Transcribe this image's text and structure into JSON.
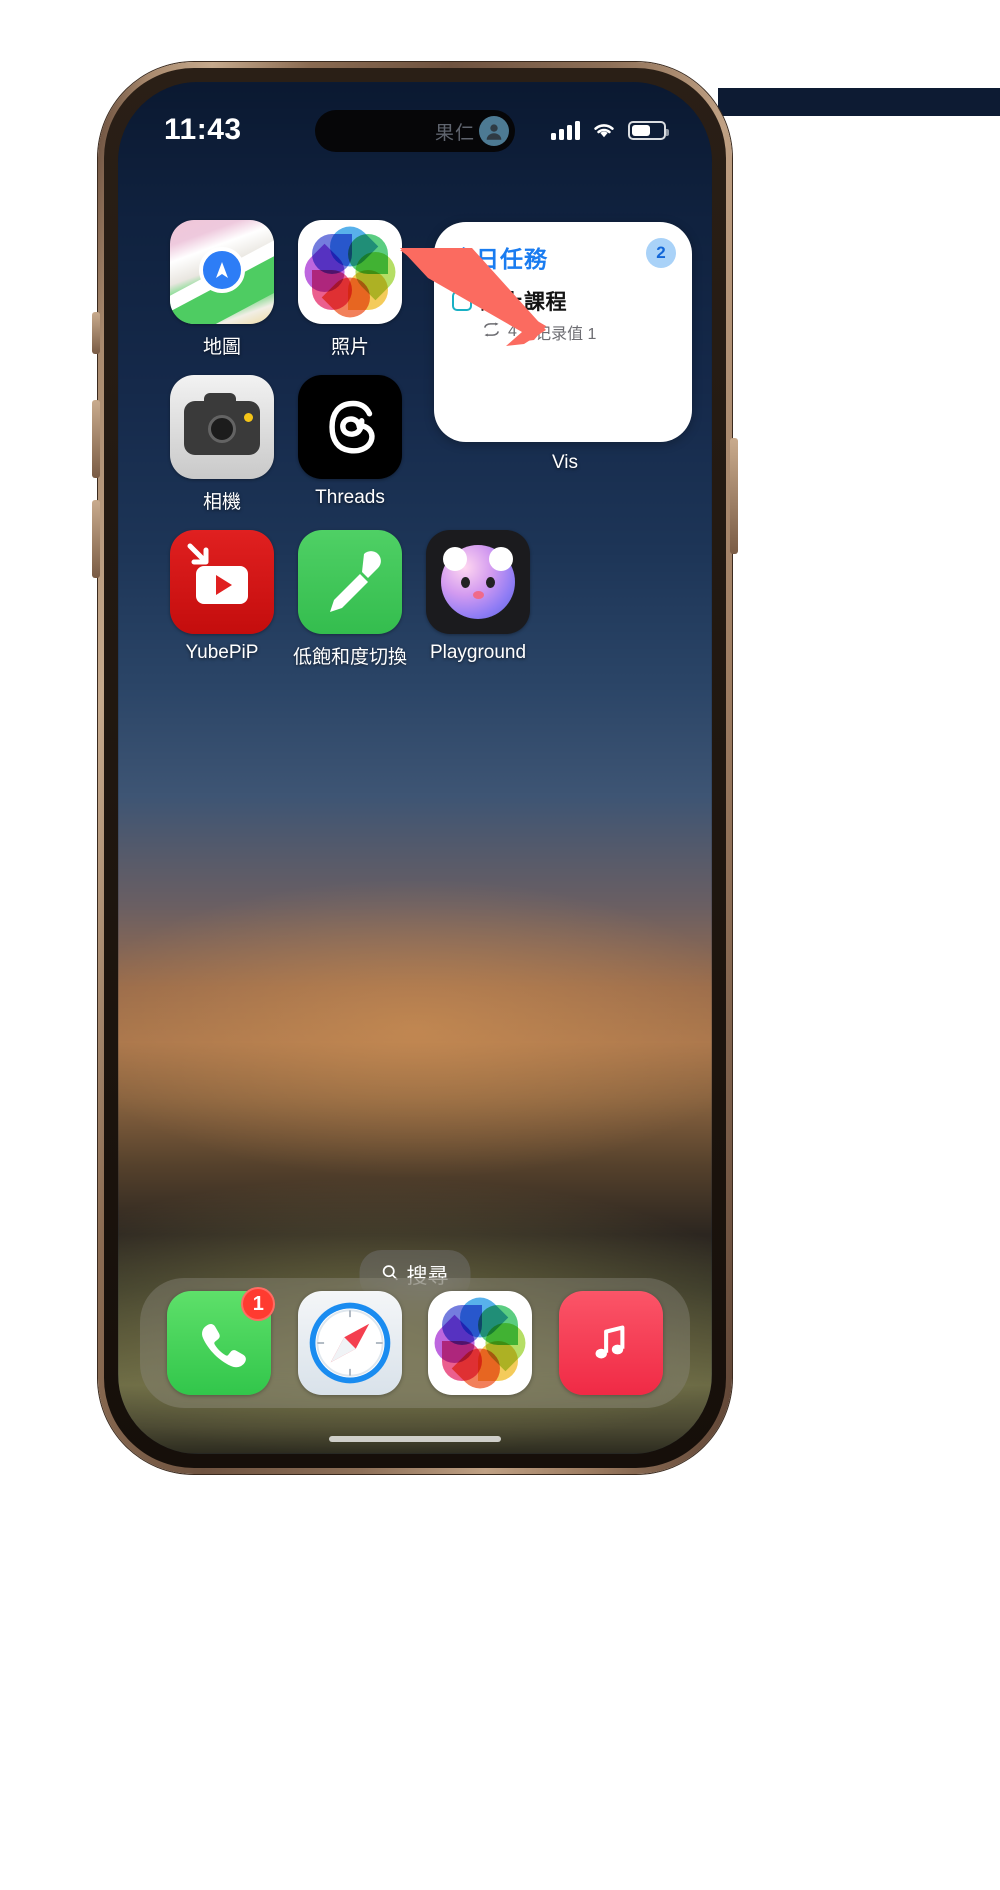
{
  "status_bar": {
    "time": "11:43",
    "dynamic_island_label": "果仁",
    "icons": {
      "cellular": "signal-bars-icon",
      "wifi": "wifi-icon",
      "battery": "battery-icon",
      "avatar": "person-avatar-icon"
    }
  },
  "home_screen": {
    "rows": [
      {
        "apps": [
          {
            "label": "地圖",
            "icon": "maps-icon"
          },
          {
            "label": "照片",
            "icon": "photos-icon"
          }
        ]
      },
      {
        "apps": [
          {
            "label": "相機",
            "icon": "camera-icon"
          },
          {
            "label": "Threads",
            "icon": "threads-icon"
          }
        ]
      },
      {
        "apps": [
          {
            "label": "YubePiP",
            "icon": "yubepip-icon"
          },
          {
            "label": "低飽和度切換",
            "icon": "eyedropper-icon"
          },
          {
            "label": "Playground",
            "icon": "playground-icon"
          }
        ]
      }
    ]
  },
  "widget": {
    "label": "Vis",
    "title": "今日任務",
    "badge": "2",
    "task": {
      "name": "線上課程",
      "checkbox_state": "unchecked",
      "repeat_icon": "repeat-icon",
      "repeat_count": "4",
      "separator": "|",
      "record_label": "记录值 1"
    }
  },
  "annotation": {
    "arrow_color": "#fb6b60",
    "points_to": "widget"
  },
  "search": {
    "label": "搜尋",
    "icon": "search-icon"
  },
  "dock": {
    "apps": [
      {
        "label": "Phone",
        "icon": "phone-icon",
        "badge": "1"
      },
      {
        "label": "Safari",
        "icon": "safari-icon",
        "badge": ""
      },
      {
        "label": "Photos",
        "icon": "photos-icon",
        "badge": ""
      },
      {
        "label": "Music",
        "icon": "music-icon",
        "badge": ""
      }
    ]
  },
  "colors": {
    "widget_title": "#1a7cf0",
    "checkbox": "#19b0c4",
    "badge_bg": "#a9d2f8",
    "arrow": "#fb6b60",
    "notification_badge": "#ff3b30"
  }
}
